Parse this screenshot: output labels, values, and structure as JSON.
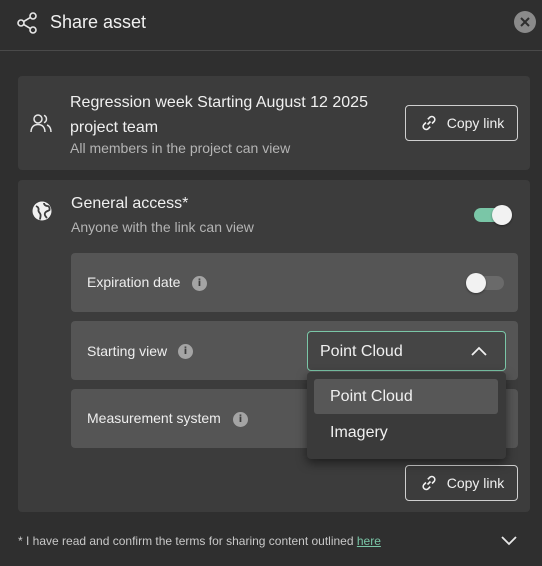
{
  "header": {
    "title": "Share asset",
    "share_icon": "share-icon",
    "close_icon": "close-icon"
  },
  "team": {
    "name": "Regression week Starting August 12 2025 project team",
    "subtitle": "All members in the project can view",
    "copy_link_label": "Copy link",
    "icon": "people-icon"
  },
  "general_access": {
    "title": "General access*",
    "subtitle": "Anyone with the link can view",
    "enabled": true,
    "icon": "globe-icon",
    "expiration": {
      "label": "Expiration date",
      "enabled": false
    },
    "starting_view": {
      "label": "Starting view",
      "selected": "Point Cloud",
      "options": [
        "Point Cloud",
        "Imagery"
      ]
    },
    "measurement": {
      "label": "Measurement system"
    },
    "copy_link_label": "Copy link"
  },
  "footer": {
    "terms_text": "* I have read and confirm the terms for sharing content outlined ",
    "terms_link": "here"
  },
  "colors": {
    "background": "#2f2f2f",
    "card": "#3c3c3c",
    "subrow": "#555555",
    "accent": "#7ac6a7"
  }
}
